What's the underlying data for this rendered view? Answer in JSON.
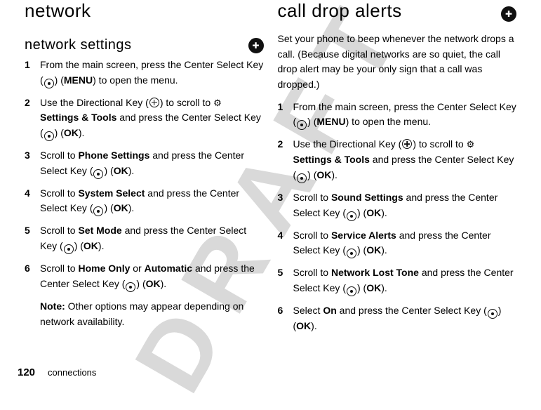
{
  "watermark": "DRAFT",
  "left": {
    "heading1": "network",
    "heading2": "network settings",
    "steps": [
      {
        "num": "1",
        "pre": "From the main screen, press the Center Select Key (",
        "post": ") (",
        "bold1": "MENU",
        "tail": ") to open the menu."
      },
      {
        "num": "2",
        "pre": "Use the Directional Key (",
        "mid1": ") to scroll to ",
        "icon2": true,
        "bold1": "Settings & Tools",
        "mid2": " and press the Center Select Key (",
        "post": ") (",
        "bold2": "OK",
        "tail": ")."
      },
      {
        "num": "3",
        "pre": "Scroll to ",
        "bold1": "Phone Settings",
        "mid1": " and press the Center Select Key (",
        "post": ") (",
        "bold2": "OK",
        "tail": ")."
      },
      {
        "num": "4",
        "pre": "Scroll to ",
        "bold1": "System Select",
        "mid1": " and press the Center Select Key (",
        "post": ") (",
        "bold2": "OK",
        "tail": ")."
      },
      {
        "num": "5",
        "pre": "Scroll to ",
        "bold1": "Set Mode",
        "mid1": " and press the Center Select Key (",
        "post": ") (",
        "bold2": "OK",
        "tail": ")."
      },
      {
        "num": "6",
        "pre": "Scroll to ",
        "bold1": "Home Only",
        "mid1": " or ",
        "bold2": "Automatic",
        "mid2": " and press the Center Select Key (",
        "post": ") (",
        "bold3": "OK",
        "tail": ")."
      }
    ],
    "note_label": "Note:",
    "note_text": " Other options may appear depending on network availability."
  },
  "right": {
    "heading1": "call drop alerts",
    "intro": "Set your phone to beep whenever the network drops a call. (Because digital networks are so quiet, the call drop alert may be your only sign that a call was dropped.)",
    "steps": [
      {
        "num": "1",
        "pre": "From the main screen, press the Center Select Key (",
        "post": ") (",
        "bold1": "MENU",
        "tail": ") to open the menu."
      },
      {
        "num": "2",
        "pre": "Use the Directional Key (",
        "mid1": ") to scroll to ",
        "icon2": true,
        "bold1": "Settings & Tools",
        "mid2": " and press the Center Select Key (",
        "post": ") (",
        "bold2": "OK",
        "tail": ")."
      },
      {
        "num": "3",
        "pre": "Scroll to ",
        "bold1": "Sound Settings",
        "mid1": " and press the Center Select Key (",
        "post": ") (",
        "bold2": "OK",
        "tail": ")."
      },
      {
        "num": "4",
        "pre": "Scroll to ",
        "bold1": "Service Alerts",
        "mid1": " and press the Center Select Key (",
        "post": ") (",
        "bold2": "OK",
        "tail": ")."
      },
      {
        "num": "5",
        "pre": "Scroll to ",
        "bold1": "Network Lost Tone",
        "mid1": " and press the Center Select Key (",
        "post": ") (",
        "bold2": "OK",
        "tail": ")."
      },
      {
        "num": "6",
        "pre": "Select ",
        "bold1": "On",
        "mid1": " and press the Center Select Key (",
        "post": ") (",
        "bold2": "OK",
        "tail": ")."
      }
    ]
  },
  "footer": {
    "page": "120",
    "section": "connections"
  }
}
